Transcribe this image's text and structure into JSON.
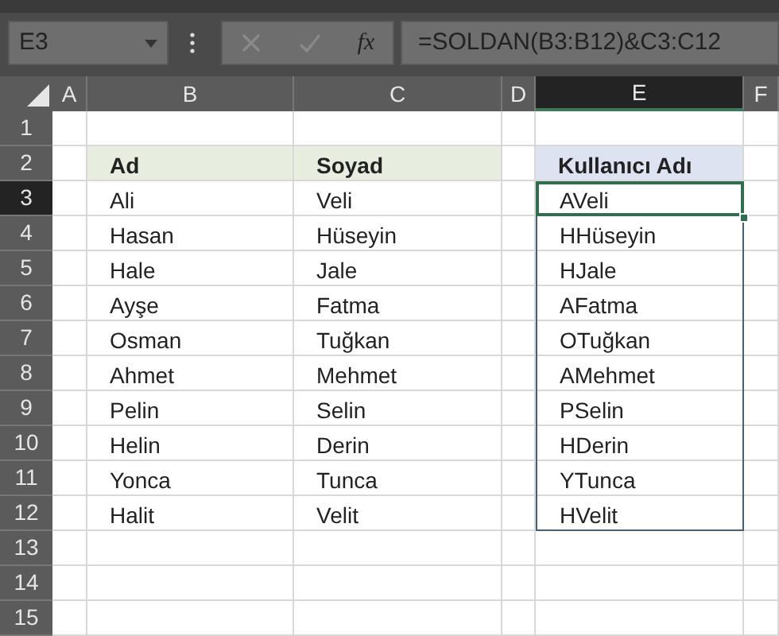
{
  "name_box": {
    "value": "E3"
  },
  "formula_bar": {
    "cancel_disabled": true,
    "enter_disabled": true,
    "fx": "fx",
    "formula": "=SOLDAN(B3:B12)&C3:C12"
  },
  "columns": [
    {
      "label": "A",
      "selected": false
    },
    {
      "label": "B",
      "selected": false
    },
    {
      "label": "C",
      "selected": false
    },
    {
      "label": "D",
      "selected": false
    },
    {
      "label": "E",
      "selected": true
    },
    {
      "label": "F",
      "selected": false
    }
  ],
  "rows": [
    {
      "number": "1",
      "selected": false
    },
    {
      "number": "2",
      "selected": false,
      "cells": {
        "B": {
          "text": "Ad",
          "kind": "header",
          "color": "#e8eedf",
          "selected": false,
          "bordered": false
        },
        "C": {
          "text": "Soyad",
          "kind": "header",
          "color": "#e8eedf",
          "selected": false,
          "bordered": false
        },
        "E": {
          "text": "Kullanıcı Adı",
          "kind": "header",
          "color": "#dde3f1",
          "selected": false,
          "bordered": false
        }
      }
    },
    {
      "number": "3",
      "selected": true,
      "cells": {
        "B": {
          "text": "Ali",
          "kind": "value",
          "selected": false,
          "bordered": false
        },
        "C": {
          "text": "Veli",
          "kind": "value",
          "selected": false,
          "bordered": false
        },
        "E": {
          "text": "AVeli",
          "kind": "value",
          "selected": true,
          "bordered": true
        }
      }
    },
    {
      "number": "4",
      "selected": false,
      "cells": {
        "B": {
          "text": "Hasan",
          "kind": "value",
          "selected": false,
          "bordered": false
        },
        "C": {
          "text": "Hüseyin",
          "kind": "value",
          "selected": false,
          "bordered": false
        },
        "E": {
          "text": "HHüseyin",
          "kind": "value",
          "selected": false,
          "bordered": true
        }
      }
    },
    {
      "number": "5",
      "selected": false,
      "cells": {
        "B": {
          "text": "Hale",
          "kind": "value",
          "selected": false,
          "bordered": false
        },
        "C": {
          "text": "Jale",
          "kind": "value",
          "selected": false,
          "bordered": false
        },
        "E": {
          "text": "HJale",
          "kind": "value",
          "selected": false,
          "bordered": true
        }
      }
    },
    {
      "number": "6",
      "selected": false,
      "cells": {
        "B": {
          "text": "Ayşe",
          "kind": "value",
          "selected": false,
          "bordered": false
        },
        "C": {
          "text": "Fatma",
          "kind": "value",
          "selected": false,
          "bordered": false
        },
        "E": {
          "text": "AFatma",
          "kind": "value",
          "selected": false,
          "bordered": true
        }
      }
    },
    {
      "number": "7",
      "selected": false,
      "cells": {
        "B": {
          "text": "Osman",
          "kind": "value",
          "selected": false,
          "bordered": false
        },
        "C": {
          "text": "Tuğkan",
          "kind": "value",
          "selected": false,
          "bordered": false
        },
        "E": {
          "text": "OTuğkan",
          "kind": "value",
          "selected": false,
          "bordered": true
        }
      }
    },
    {
      "number": "8",
      "selected": false,
      "cells": {
        "B": {
          "text": "Ahmet",
          "kind": "value",
          "selected": false,
          "bordered": false
        },
        "C": {
          "text": "Mehmet",
          "kind": "value",
          "selected": false,
          "bordered": false
        },
        "E": {
          "text": "AMehmet",
          "kind": "value",
          "selected": false,
          "bordered": true
        }
      }
    },
    {
      "number": "9",
      "selected": false,
      "cells": {
        "B": {
          "text": "Pelin",
          "kind": "value",
          "selected": false,
          "bordered": false
        },
        "C": {
          "text": "Selin",
          "kind": "value",
          "selected": false,
          "bordered": false
        },
        "E": {
          "text": "PSelin",
          "kind": "value",
          "selected": false,
          "bordered": true
        }
      }
    },
    {
      "number": "10",
      "selected": false,
      "cells": {
        "B": {
          "text": "Helin",
          "kind": "value",
          "selected": false,
          "bordered": false
        },
        "C": {
          "text": "Derin",
          "kind": "value",
          "selected": false,
          "bordered": false
        },
        "E": {
          "text": "HDerin",
          "kind": "value",
          "selected": false,
          "bordered": true
        }
      }
    },
    {
      "number": "11",
      "selected": false,
      "cells": {
        "B": {
          "text": "Yonca",
          "kind": "value",
          "selected": false,
          "bordered": false
        },
        "C": {
          "text": "Tunca",
          "kind": "value",
          "selected": false,
          "bordered": false
        },
        "E": {
          "text": "YTunca",
          "kind": "value",
          "selected": false,
          "bordered": true
        }
      }
    },
    {
      "number": "12",
      "selected": false,
      "cells": {
        "B": {
          "text": "Halit",
          "kind": "value",
          "selected": false,
          "bordered": false
        },
        "C": {
          "text": "Velit",
          "kind": "value",
          "selected": false,
          "bordered": false
        },
        "E": {
          "text": "HVelit",
          "kind": "value",
          "selected": false,
          "bordered": true
        }
      }
    },
    {
      "number": "13",
      "selected": false
    },
    {
      "number": "14",
      "selected": false
    },
    {
      "number": "15",
      "selected": false
    }
  ]
}
